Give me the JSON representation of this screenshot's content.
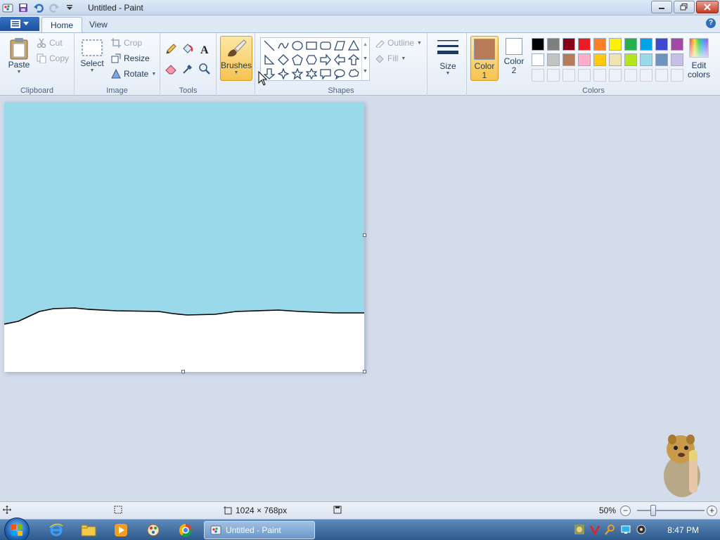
{
  "window": {
    "title": "Untitled - Paint"
  },
  "tabs": [
    {
      "label": "Home",
      "active": true
    },
    {
      "label": "View",
      "active": false
    }
  ],
  "clipboard": {
    "paste": "Paste",
    "cut": "Cut",
    "copy": "Copy",
    "label": "Clipboard"
  },
  "image": {
    "select": "Select",
    "crop": "Crop",
    "resize": "Resize",
    "rotate": "Rotate",
    "label": "Image"
  },
  "tools": {
    "label": "Tools"
  },
  "brushes": {
    "label": "Brushes"
  },
  "shapes": {
    "outline": "Outline",
    "fill": "Fill",
    "label": "Shapes"
  },
  "size": {
    "label": "Size"
  },
  "colors": {
    "color1_line1": "Color",
    "color1_line2": "1",
    "color2_line1": "Color",
    "color2_line2": "2",
    "edit_line1": "Edit",
    "edit_line2": "colors",
    "label": "Colors",
    "color1_value": "#b97a57",
    "color2_value": "#ffffff",
    "palette_row1": [
      "#000000",
      "#7f7f7f",
      "#880015",
      "#ed1c24",
      "#ff7f27",
      "#fff200",
      "#22b14c",
      "#00a2e8",
      "#3f48cc",
      "#a349a4"
    ],
    "palette_row2": [
      "#ffffff",
      "#c3c3c3",
      "#b97a57",
      "#ffaec9",
      "#ffc90e",
      "#efe4b0",
      "#b5e61d",
      "#99d9ea",
      "#7092be",
      "#c8bfe7"
    ]
  },
  "canvas": {
    "sky_color": "#99d9ea",
    "ground_color": "#ffffff"
  },
  "status": {
    "dimensions": "1024 × 768px",
    "zoom": "50%"
  },
  "taskbar": {
    "active_task": "Untitled - Paint",
    "clock": "8:47 PM"
  }
}
